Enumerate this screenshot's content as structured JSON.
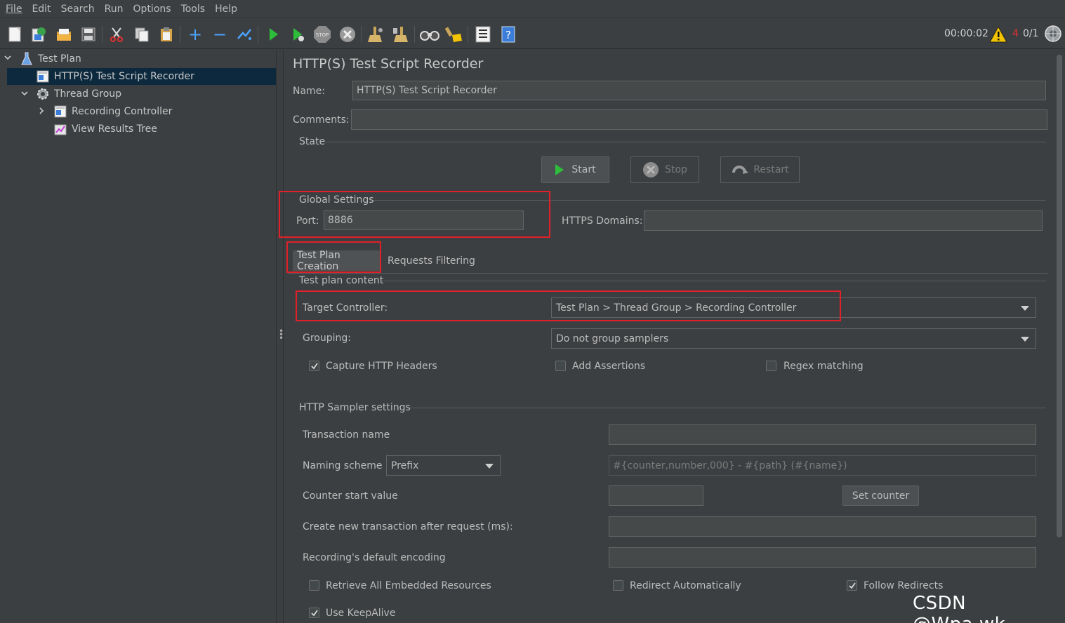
{
  "menu": [
    "File",
    "Edit",
    "Search",
    "Run",
    "Options",
    "Tools",
    "Help"
  ],
  "toolbar": {
    "icons": [
      "new-icon",
      "templates-icon",
      "open-icon",
      "save-icon",
      "cut-icon",
      "copy-icon",
      "paste-icon",
      "expand-icon",
      "collapse-icon",
      "toggle-icon",
      "start-icon",
      "start-no-pause-icon",
      "stop-icon",
      "shutdown-icon",
      "clear-icon",
      "clear-all-icon",
      "search-icon",
      "reset-search-icon",
      "function-helper-icon",
      "help-icon"
    ],
    "timer": "00:00:02",
    "error_count": "4",
    "threads": "0/1"
  },
  "tree": {
    "items": [
      {
        "label": "Test Plan",
        "icon": "test-plan-icon"
      },
      {
        "label": "HTTP(S) Test Script Recorder",
        "icon": "recorder-icon"
      },
      {
        "label": "Thread Group",
        "icon": "gear-icon"
      },
      {
        "label": "Recording Controller",
        "icon": "controller-icon"
      },
      {
        "label": "View Results Tree",
        "icon": "results-tree-icon"
      }
    ]
  },
  "panel": {
    "title": "HTTP(S) Test Script Recorder",
    "name_label": "Name:",
    "name_value": "HTTP(S) Test Script Recorder",
    "comments_label": "Comments:",
    "comments_value": "",
    "state_label": "State",
    "start_label": "Start",
    "stop_label": "Stop",
    "restart_label": "Restart",
    "global_settings_label": "Global Settings",
    "port_label": "Port:",
    "port_value": "8886",
    "https_domains_label": "HTTPS Domains:",
    "https_domains_value": "",
    "tabs": [
      "Test Plan Creation",
      "Requests Filtering"
    ],
    "test_plan_content_label": "Test plan content",
    "target_controller_label": "Target Controller:",
    "target_controller_value": "Test Plan > Thread Group > Recording Controller",
    "grouping_label": "Grouping:",
    "grouping_value": "Do not group samplers",
    "capture_headers_label": "Capture HTTP Headers",
    "add_assertions_label": "Add Assertions",
    "regex_matching_label": "Regex matching",
    "http_sampler_settings_label": "HTTP Sampler settings",
    "transaction_name_label": "Transaction name",
    "transaction_name_value": "",
    "naming_scheme_label": "Naming scheme",
    "naming_scheme_value": "Prefix",
    "naming_format_placeholder": "#{counter,number,000} - #{path} (#{name})",
    "counter_start_label": "Counter start value",
    "counter_start_value": "",
    "set_counter_label": "Set counter",
    "new_transaction_label": "Create new transaction after request (ms):",
    "new_transaction_value": "",
    "default_encoding_label": "Recording's default encoding",
    "default_encoding_value": "",
    "retrieve_resources_label": "Retrieve All Embedded Resources",
    "redirect_auto_label": "Redirect Automatically",
    "follow_redirects_label": "Follow Redirects",
    "use_keepalive_label": "Use KeepAlive"
  },
  "checkboxes": {
    "capture_headers": true,
    "add_assertions": false,
    "regex_matching": false,
    "retrieve_resources": false,
    "redirect_auto": false,
    "follow_redirects": true,
    "use_keepalive": true
  },
  "watermark": "CSDN @Wpa.wk",
  "colors": {
    "background": "#3c3f41",
    "selection": "#0d293e",
    "highlight_box": "#e0202a",
    "error": "#e03030"
  }
}
